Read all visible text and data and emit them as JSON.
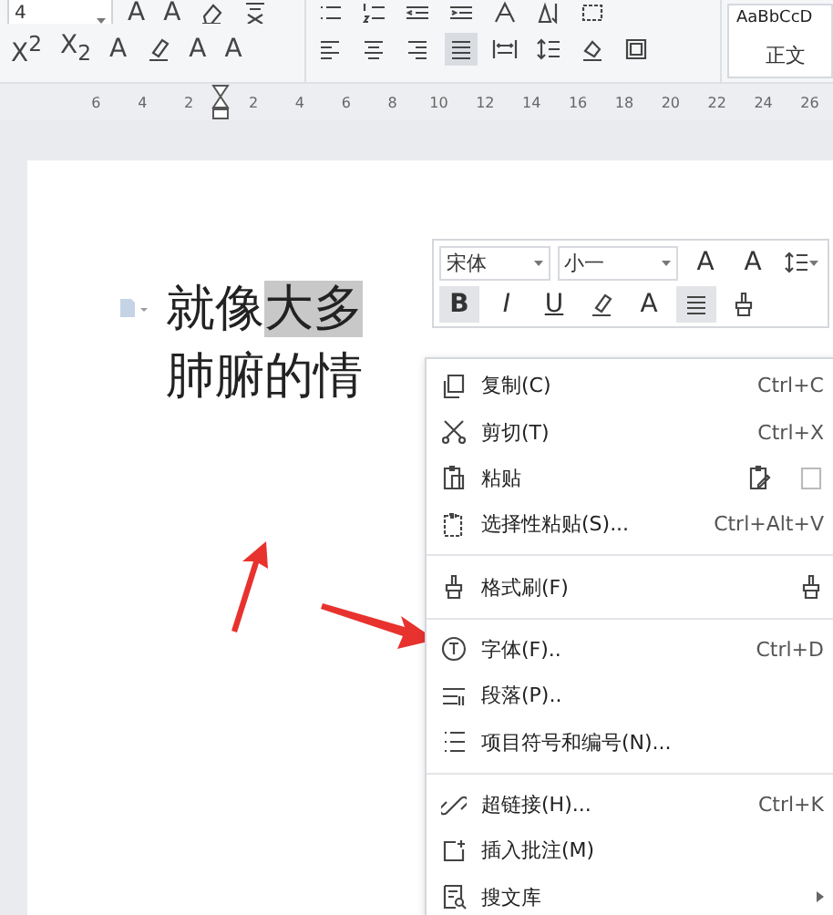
{
  "ribbon": {
    "font_size": {
      "value": "4"
    },
    "font_row1": [
      {
        "kind": "grow",
        "label": "A"
      },
      {
        "kind": "shrink",
        "label": "A"
      },
      {
        "kind": "eraser"
      },
      {
        "kind": "pinyin"
      }
    ],
    "font_row2": [
      {
        "kind": "text",
        "label": "X$^{2}$"
      },
      {
        "kind": "text",
        "label": "X$_{2}$"
      },
      {
        "kind": "effect",
        "label": "A"
      },
      {
        "kind": "highlight"
      },
      {
        "kind": "color",
        "label": "A"
      },
      {
        "kind": "boxed",
        "label": "A"
      }
    ],
    "para_row1": [
      {
        "kind": "bullets"
      },
      {
        "kind": "numbering"
      },
      {
        "kind": "outdent"
      },
      {
        "kind": "indent"
      },
      {
        "kind": "layout"
      },
      {
        "kind": "sort"
      },
      {
        "kind": "marks"
      }
    ],
    "para_row2": [
      {
        "kind": "align-left",
        "selected": false
      },
      {
        "kind": "align-center",
        "selected": false
      },
      {
        "kind": "align-right",
        "selected": false
      },
      {
        "kind": "justify",
        "selected": true
      },
      {
        "kind": "distribute",
        "selected": false
      },
      {
        "kind": "spacing",
        "selected": false
      },
      {
        "kind": "shading",
        "selected": false
      },
      {
        "kind": "border",
        "selected": false
      }
    ],
    "style": {
      "sample": "AaBbCcD",
      "name": "正文"
    }
  },
  "ruler": {
    "left_ticks": [
      "6",
      "4",
      "2"
    ],
    "right_ticks": [
      "2",
      "4",
      "6",
      "8",
      "10",
      "12",
      "14",
      "16",
      "18",
      "20",
      "22",
      "24",
      "26"
    ]
  },
  "document": {
    "lines": [
      [
        {
          "text": "就像",
          "selected": false
        },
        {
          "text": "大多",
          "selected": true
        }
      ],
      [
        {
          "text": "肺腑的情",
          "selected": false
        }
      ]
    ]
  },
  "mini_toolbar": {
    "font": "宋体",
    "size": "小一",
    "row1": [
      {
        "kind": "grow",
        "label": "A"
      },
      {
        "kind": "shrink",
        "label": "A"
      },
      {
        "kind": "spacing"
      }
    ],
    "row2": [
      {
        "kind": "bold",
        "label": "B",
        "selected": true
      },
      {
        "kind": "italic",
        "label": "I",
        "selected": false
      },
      {
        "kind": "underline",
        "label": "U",
        "selected": false
      },
      {
        "kind": "highlight",
        "selected": false
      },
      {
        "kind": "color",
        "label": "A",
        "selected": false
      },
      {
        "kind": "align",
        "selected": true
      },
      {
        "kind": "painter",
        "selected": false
      }
    ]
  },
  "context_menu": {
    "groups": [
      [
        {
          "kind": "copy",
          "label": "复制(C)",
          "shortcut": "Ctrl+C"
        },
        {
          "kind": "cut",
          "label": "剪切(T)",
          "shortcut": "Ctrl+X"
        },
        {
          "kind": "paste",
          "label": "粘贴",
          "extra": {
            "kind": "paste-options"
          }
        },
        {
          "kind": "paste-special",
          "label": "选择性粘贴(S)...",
          "shortcut": "Ctrl+Alt+V"
        }
      ],
      [
        {
          "kind": "painter",
          "label": "格式刷(F)",
          "extra": {
            "kind": "painter"
          }
        }
      ],
      [
        {
          "kind": "font",
          "label": "字体(F)..",
          "shortcut": "Ctrl+D"
        },
        {
          "kind": "paragraph",
          "label": "段落(P).."
        },
        {
          "kind": "bullets",
          "label": "项目符号和编号(N)..."
        }
      ],
      [
        {
          "kind": "link",
          "label": "超链接(H)...",
          "shortcut": "Ctrl+K"
        },
        {
          "kind": "comment",
          "label": "插入批注(M)"
        },
        {
          "kind": "library",
          "label": "搜文库",
          "extra": {
            "kind": "submenu"
          }
        }
      ]
    ]
  }
}
